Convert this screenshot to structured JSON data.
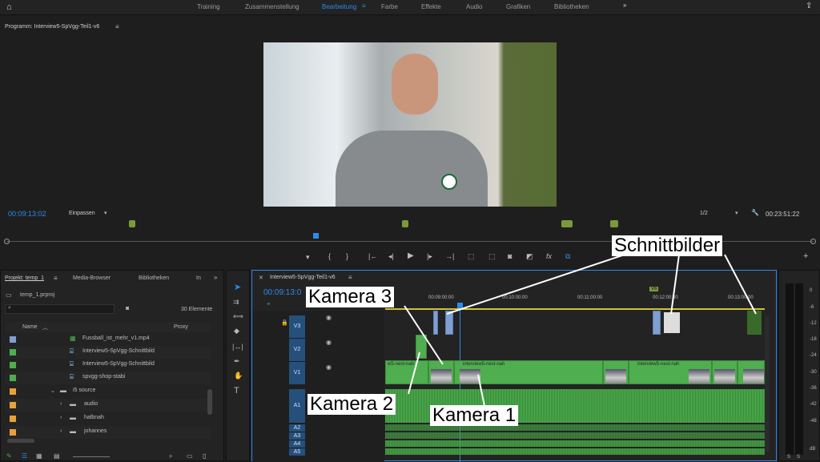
{
  "topbar": {
    "tabs": [
      "Training",
      "Zusammenstellung",
      "Bearbeitung",
      "Farbe",
      "Effekte",
      "Audio",
      "Grafiken",
      "Bibliotheken"
    ],
    "active": "Bearbeitung"
  },
  "program": {
    "title": "Programm: Interview5-SpVgg-Teil1-v6",
    "timecode": "00:09:13:02",
    "fit": "Einpassen",
    "quality": "1/2",
    "duration": "00:23:51:22"
  },
  "project": {
    "title": "Projekt: temp_1",
    "tabs": [
      "Media-Browser",
      "Bibliotheken",
      "In"
    ],
    "file": "temp_1.prproj",
    "count": "30 Elemente",
    "col_name": "Name",
    "col_proxy": "Proxy",
    "items": [
      {
        "name": "Fussball_ist_mehr_v1.mp4",
        "color": "#7f9fd0"
      },
      {
        "name": "Interview5-SpVgg-Schnittbild",
        "color": "#4fae4f"
      },
      {
        "name": "Interview5-SpVgg-Schnittbild",
        "color": "#4fae4f"
      },
      {
        "name": "spvgg-shop-stabi",
        "color": "#4fae4f"
      },
      {
        "name": "i5 source",
        "color": "#e8a13a"
      },
      {
        "name": "audio",
        "color": "#e8a13a"
      },
      {
        "name": "halbnah",
        "color": "#e8a13a"
      },
      {
        "name": "johannes",
        "color": "#e8a13a"
      }
    ]
  },
  "timeline": {
    "title": "Interview5-SpVgg-Teil1-v6",
    "timecode": "00:09:13:0",
    "ruler": [
      "00:09:00:00",
      "00:10:00:00",
      "00:11:00:00",
      "00:12:00:00",
      "00:13:00:00"
    ],
    "tracks": [
      "V3",
      "V2",
      "V1",
      "A1",
      "A2",
      "A3",
      "A4",
      "A5"
    ],
    "clip_label": "interview5-nest-nah",
    "clip_label_short": "w5-nest-nah",
    "marker": "V6"
  },
  "meter": {
    "scale": [
      "0",
      "-6",
      "-12",
      "-18",
      "-24",
      "-30",
      "-36",
      "-42",
      "-48",
      "dB"
    ],
    "solo": [
      "S",
      "S"
    ]
  },
  "callouts": {
    "schnittbilder": "Schnittbilder",
    "kamera3": "Kamera 3",
    "kamera2": "Kamera 2",
    "kamera1": "Kamera 1"
  }
}
